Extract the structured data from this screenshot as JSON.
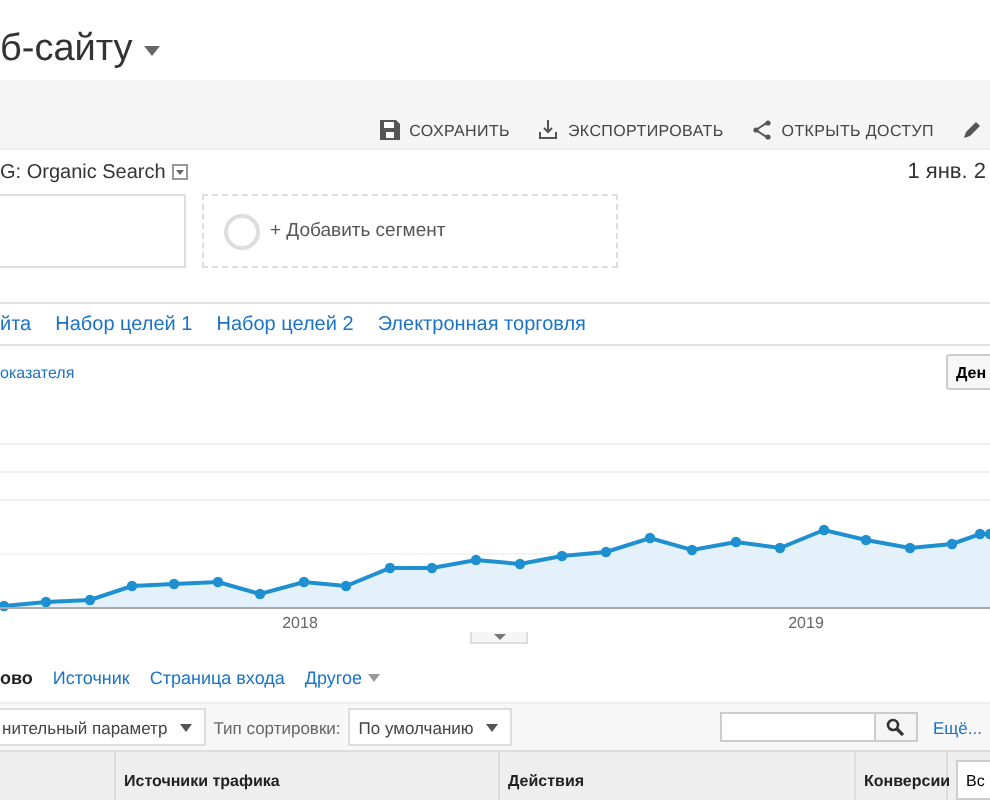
{
  "header": {
    "title": "б-сайту"
  },
  "toolbar": {
    "buttons": [
      {
        "kind": "save",
        "label": "СОХРАНИТЬ"
      },
      {
        "kind": "export",
        "label": "ЭКСПОРТИРОВАТЬ"
      },
      {
        "kind": "share",
        "label": "ОТКРЫТЬ ДОСТУП"
      },
      {
        "kind": "edit"
      }
    ]
  },
  "segments": {
    "label": "G: Organic Search",
    "date": "1 янв. 2",
    "add_segment": "+ Добавить сегмент"
  },
  "explorer_tabs": [
    {
      "label": "йта",
      "selected": false
    },
    {
      "label": "Набор целей 1",
      "selected": false
    },
    {
      "label": "Набор целей 2",
      "selected": false
    },
    {
      "label": "Электронная торговля",
      "selected": false
    }
  ],
  "metric_link": "оказателя",
  "interval_button": "Ден",
  "chart": {
    "x_labels": [
      "2018",
      "2019"
    ]
  },
  "dimension_tabs": [
    {
      "label": "ово",
      "selected": true,
      "kind": "tab"
    },
    {
      "label": "Источник",
      "selected": false,
      "kind": "tab"
    },
    {
      "label": "Страница входа",
      "selected": false,
      "kind": "tab"
    },
    {
      "label": "Другое",
      "selected": false,
      "kind": "menu"
    }
  ],
  "filters": {
    "secondary_dimension": "нительный параметр",
    "sort_label": "Тип сортировки:",
    "sort_value": "По умолчанию",
    "more_link": "Ещё..."
  },
  "table": {
    "columns": [
      "Источники трафика",
      "Действия",
      "Конверсии"
    ],
    "conversions_select": "Вс"
  }
}
